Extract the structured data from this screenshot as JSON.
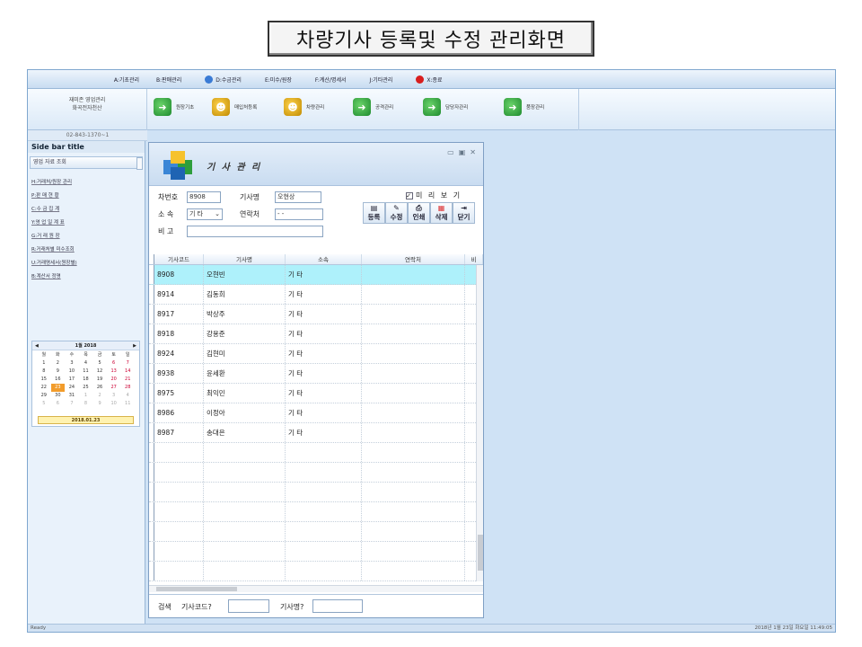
{
  "page_title": "차량기사 등록및 수정 관리화면",
  "menu": [
    "A:기초관리",
    "B:판매관리",
    "D:수금관리",
    "E:미수/원장",
    "F:계산/명세서",
    "J:기타관리",
    "X:종료"
  ],
  "company": {
    "name": "재미존 영업관리",
    "sub": "화곡전자천산",
    "phone": "02-843-1370~1"
  },
  "ribbon": [
    "원장기초",
    "매입처등록",
    "차량관리",
    "공격관리",
    "담당자관리",
    "품장관리"
  ],
  "sidebar": {
    "title": "Side bar title",
    "section": "영업 자료 조회",
    "items": [
      "H:거래처/원장 관리",
      "P:판 매 현 황",
      "C:수 금 집 계",
      "Y:영 업 일 계 표",
      "G:거 래 원 장",
      "R:거래처별 미수조회",
      "U:거래명세서(원장별)",
      "B:계산서 정명"
    ]
  },
  "calendar": {
    "month": "1월 2018",
    "weekdays": [
      "월",
      "화",
      "수",
      "목",
      "금",
      "토",
      "일"
    ],
    "footer": "2018.01.23",
    "weeks": [
      [
        "1",
        "2",
        "3",
        "4",
        "5",
        "6",
        "7"
      ],
      [
        "8",
        "9",
        "10",
        "11",
        "12",
        "13",
        "14"
      ],
      [
        "15",
        "16",
        "17",
        "18",
        "19",
        "20",
        "21"
      ],
      [
        "22",
        "23",
        "24",
        "25",
        "26",
        "27",
        "28"
      ],
      [
        "29",
        "30",
        "31",
        "1",
        "2",
        "3",
        "4"
      ],
      [
        "5",
        "6",
        "7",
        "8",
        "9",
        "10",
        "11"
      ]
    ]
  },
  "child": {
    "title": "기 사 관 리",
    "form": {
      "carno_label": "차번호",
      "carno_value": "8908",
      "driver_label": "기사명",
      "driver_value": "오현상",
      "affil_label": "소 속",
      "affil_value": "기 타",
      "contact_label": "연락처",
      "contact_value": " -  - ",
      "note_label": "비 고",
      "note_value": "",
      "preview_label": "미 리 보 기"
    },
    "buttons": [
      "등록",
      "수정",
      "인쇄",
      "삭제",
      "닫기"
    ],
    "columns": [
      "기사코드",
      "기사명",
      "소속",
      "연락처",
      "비"
    ],
    "rows": [
      {
        "code": "8908",
        "name": "오현빈",
        "affil": "기 타"
      },
      {
        "code": "8914",
        "name": "김동희",
        "affil": "기 타"
      },
      {
        "code": "8917",
        "name": "박상주",
        "affil": "기 타"
      },
      {
        "code": "8918",
        "name": "강용준",
        "affil": "기 타"
      },
      {
        "code": "8924",
        "name": "김현미",
        "affil": "기 타"
      },
      {
        "code": "8938",
        "name": "윤세환",
        "affil": "기 타"
      },
      {
        "code": "8975",
        "name": "최익민",
        "affil": "기 타"
      },
      {
        "code": "8986",
        "name": "이정아",
        "affil": "기 타"
      },
      {
        "code": "8987",
        "name": "송대은",
        "affil": "기 타"
      }
    ],
    "search": {
      "label": "검색",
      "code_label": "기사코드?",
      "name_label": "기사명?"
    }
  },
  "status": {
    "left": "Ready",
    "right": "2018년 1월 23일 화요일 11:49:05"
  }
}
